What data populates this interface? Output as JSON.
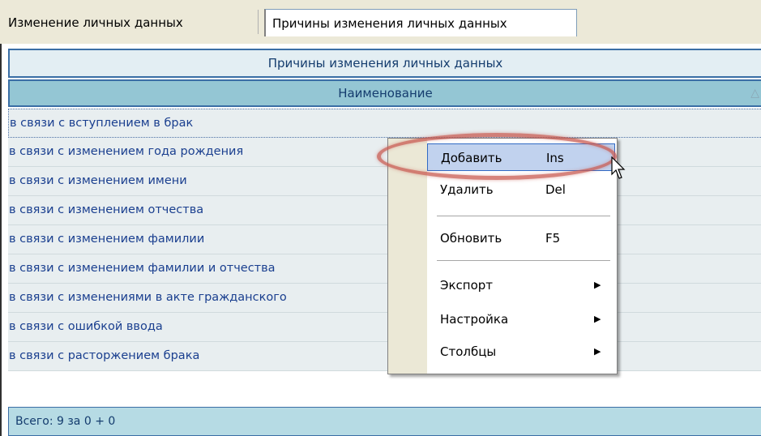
{
  "tabs": [
    {
      "label": "Изменение личных данных"
    },
    {
      "label": "Причины изменения личных данных"
    }
  ],
  "grid": {
    "title": "Причины изменения личных данных",
    "column_header": "Наименование",
    "rows": [
      "в связи с вступлением в брак",
      "в связи с изменением года рождения",
      "в связи с изменением имени",
      "в связи с изменением отчества",
      "в связи с изменением фамилии",
      "в связи с изменением фамилии и отчества",
      "в связи с изменениями в акте гражданского",
      "в связи с ошибкой ввода",
      "в связи с расторжением брака"
    ],
    "footer": "Всего: 9 за 0 + 0"
  },
  "menu": {
    "items": [
      {
        "label": "Добавить",
        "shortcut": "Ins"
      },
      {
        "label": "Удалить",
        "shortcut": "Del"
      },
      {
        "label": "Обновить",
        "shortcut": "F5"
      },
      {
        "label": "Экспорт",
        "submenu": "▶"
      },
      {
        "label": "Настройка",
        "submenu": "▶"
      },
      {
        "label": "Столбцы",
        "submenu": "▶"
      }
    ]
  },
  "colors": {
    "header_bg": "#94c6d4",
    "row_text": "#1a3f8f",
    "highlight_ring": "#c85a50"
  }
}
